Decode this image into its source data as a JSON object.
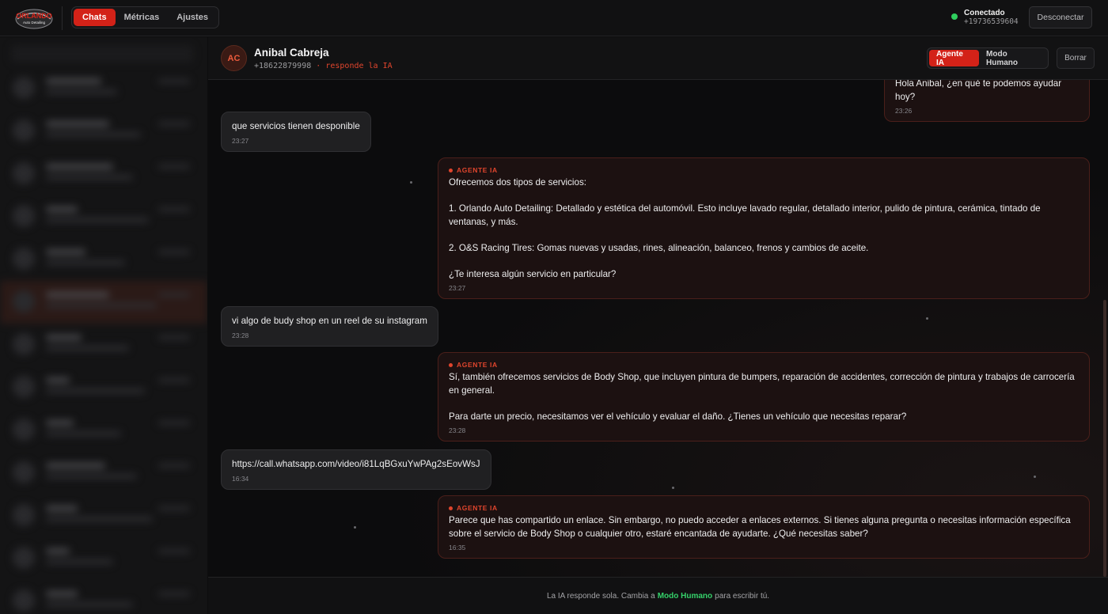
{
  "topbar": {
    "logo_title": "ORLANDO",
    "logo_subtitle": "Auto Detailing",
    "tabs": [
      {
        "label": "Chats",
        "active": true
      },
      {
        "label": "Métricas",
        "active": false
      },
      {
        "label": "Ajustes",
        "active": false
      }
    ],
    "status_label": "Conectado",
    "status_phone": "+19736539604",
    "disconnect_label": "Desconectar"
  },
  "chat": {
    "avatar_initials": "AC",
    "name": "Anibal Cabreja",
    "phone": "+18622879998",
    "separator": "·",
    "responder": "responde la IA",
    "mode_ia_label": "Agente IA",
    "mode_human_label": "Modo Humano",
    "delete_label": "Borrar"
  },
  "messages": [
    {
      "direction": "out",
      "agent_tag": "",
      "text": "Hola Anibal, ¿en qué te podemos ayudar hoy?",
      "time": "23:26"
    },
    {
      "direction": "in",
      "text": "que servicios tienen desponible",
      "time": "23:27"
    },
    {
      "direction": "out",
      "agent_tag": "AGENTE IA",
      "text": "Ofrecemos dos tipos de servicios:\n\n1. Orlando Auto Detailing: Detallado y estética del automóvil. Esto incluye lavado regular, detallado interior, pulido de pintura, cerámica, tintado de ventanas, y más.\n\n2. O&S Racing Tires: Gomas nuevas y usadas, rines, alineación, balanceo, frenos y cambios de aceite.\n\n¿Te interesa algún servicio en particular?",
      "time": "23:27"
    },
    {
      "direction": "in",
      "text": "vi algo de budy shop en un reel de su instagram",
      "time": "23:28"
    },
    {
      "direction": "out",
      "agent_tag": "AGENTE IA",
      "text": "Sí, también ofrecemos servicios de Body Shop, que incluyen pintura de bumpers, reparación de accidentes, corrección de pintura y trabajos de carrocería en general.\n\nPara darte un precio, necesitamos ver el vehículo y evaluar el daño. ¿Tienes un vehículo que necesitas reparar?",
      "time": "23:28"
    },
    {
      "direction": "in",
      "text": "https://call.whatsapp.com/video/i81LqBGxuYwPAg2sEovWsJ",
      "time": "16:34"
    },
    {
      "direction": "out",
      "agent_tag": "AGENTE IA",
      "text": "Parece que has compartido un enlace. Sin embargo, no puedo acceder a enlaces externos. Si tienes alguna pregunta o necesitas información específica sobre el servicio de Body Shop o cualquier otro, estaré encantada de ayudarte. ¿Qué necesitas saber?",
      "time": "16:35"
    }
  ],
  "footer": {
    "before": "La IA responde sola. Cambia a",
    "highlight": "Modo Humano",
    "after": "para escribir tú."
  }
}
